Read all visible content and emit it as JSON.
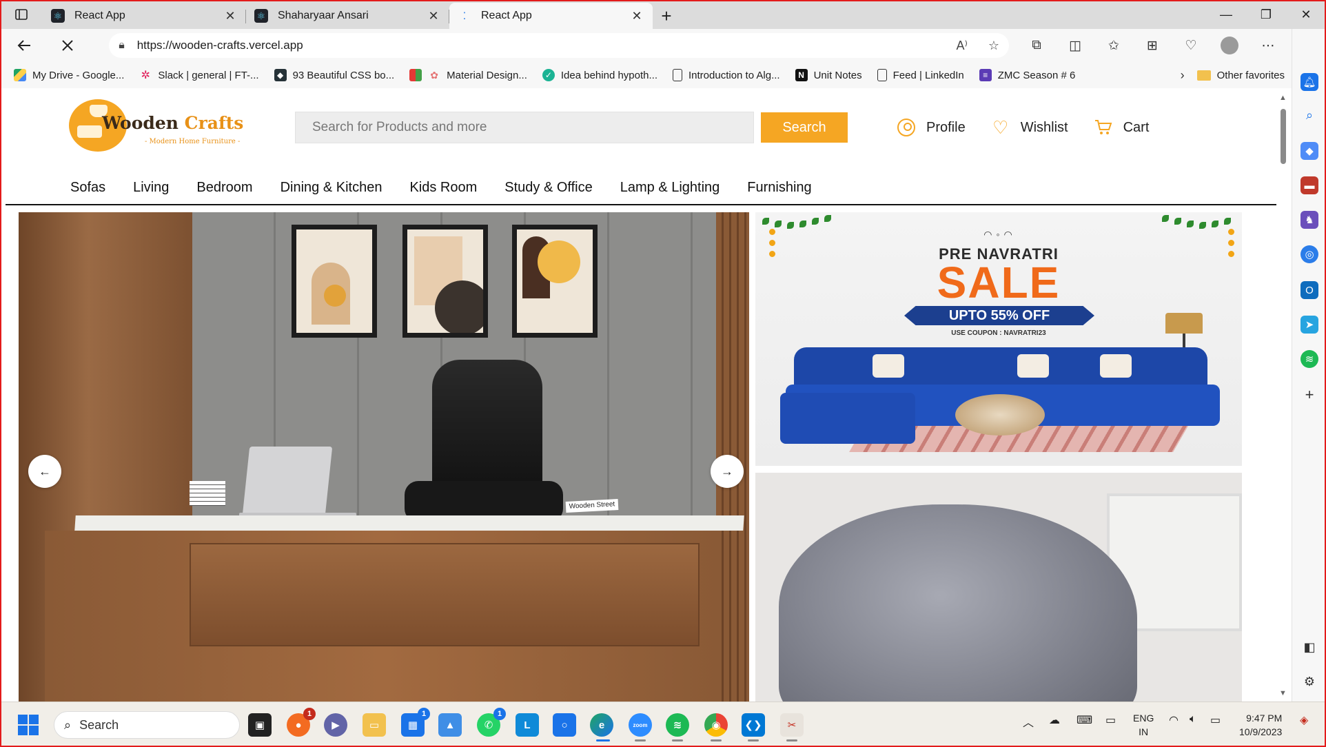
{
  "browser": {
    "tabs": [
      {
        "title": "React App",
        "active": false
      },
      {
        "title": "Shaharyaar Ansari",
        "active": false
      },
      {
        "title": "React App",
        "active": true
      }
    ],
    "url": "https://wooden-crafts.vercel.app",
    "favorites": [
      {
        "label": "My Drive - Google...",
        "icon": "google-drive-icon",
        "color": "#1fa463"
      },
      {
        "label": "Slack | general | FT-...",
        "icon": "slack-icon",
        "color": "#e01e5a"
      },
      {
        "label": "93 Beautiful CSS bo...",
        "icon": "css-icon",
        "color": "#263238"
      },
      {
        "label": "Material Design...",
        "icon": "material-icon",
        "color": "#e53935"
      },
      {
        "label": "Idea behind hypoth...",
        "icon": "idea-icon",
        "color": "#1bb394"
      },
      {
        "label": "Introduction to Alg...",
        "icon": "document-icon",
        "color": "#ffffff"
      },
      {
        "label": "Unit Notes",
        "icon": "notion-icon",
        "color": "#111111"
      },
      {
        "label": "Feed | LinkedIn",
        "icon": "document-icon",
        "color": "#ffffff"
      },
      {
        "label": "ZMC Season # 6",
        "icon": "grid-icon",
        "color": "#5b3bb5"
      }
    ],
    "other_favorites": "Other favorites"
  },
  "site": {
    "logo": {
      "word1": "Wooden",
      "word2": "Crafts",
      "tagline": "- Modern Home Furniture -"
    },
    "search": {
      "placeholder": "Search for Products and more",
      "button": "Search"
    },
    "actions": {
      "profile": "Profile",
      "wishlist": "Wishlist",
      "cart": "Cart"
    },
    "categories": [
      "Sofas",
      "Living",
      "Bedroom",
      "Dining & Kitchen",
      "Kids Room",
      "Study & Office",
      "Lamp & Lighting",
      "Furnishing"
    ],
    "hero": {
      "prev": "←",
      "next": "→",
      "desk_tag": "Wooden Street"
    },
    "promo": {
      "headline": "PRE NAVRATRI",
      "sale": "SALE",
      "offer": "UPTO 55% OFF",
      "coupon": "USE COUPON : NAVRATRI23"
    },
    "accent_color": "#f5a623"
  },
  "taskbar": {
    "search": "Search",
    "language": "ENG",
    "region": "IN",
    "time": "9:47 PM",
    "date": "10/9/2023",
    "badges": {
      "firefox": "1",
      "store": "1",
      "whatsapp": "1"
    }
  }
}
